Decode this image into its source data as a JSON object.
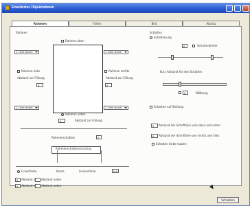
{
  "window": {
    "title": "Erweitertes Objektrahmen"
  },
  "tabs": [
    {
      "label": "Rahmen"
    },
    {
      "label": "Füllen"
    },
    {
      "label": "Bild"
    },
    {
      "label": "Absatz"
    }
  ],
  "left": {
    "rahmen_label": "Rahmen",
    "top_line_checkbox": "Rahmen oben",
    "top_line_distance_label": "Abstand zur Füllung",
    "top_distance_value": "0",
    "left_dropdown": "1 Linie durch",
    "left_line_checkbox": "Rahmen links",
    "left_distance_label": "Abstand zur Füllung",
    "left_distance_value": "0",
    "right_dropdown": "1 Linie durch",
    "right_line_checkbox": "Rahmen rechts",
    "right_distance_label": "Abstand zur Füllung",
    "right_distance_value": "0",
    "bottom_left_dropdown": "1 Linie durch",
    "bottom_right_dropdown": "1 Linie durch",
    "bottom_line_checkbox": "Rahmen unten",
    "bottom_distance_label": "Abstand zur Füllung",
    "bottom_distance_value": "0",
    "shadow_label": "Rahmenschatten",
    "shadow_value": "0",
    "shadow_preview_label": "Rahmenschattenvorschau",
    "line_label": "Linienfarbe",
    "line_value": "Kante",
    "line_strength_label": "Linienstärke",
    "line_strength_value": "0,5",
    "space_top_label": "Abstand oben",
    "space_top_value": "0",
    "space_top_unit": "Abstand unten",
    "space_bottom_label": "Abstand oben",
    "space_bottom_value": "0",
    "space_bottom_unit": "Abstand unten"
  },
  "right": {
    "header": "Schatten",
    "shadow_checkbox": "Schattierung",
    "shadow_value": "0",
    "shadow_unit": "Schattenbreite",
    "slider_label": "Kurz Abstand für den Schatten",
    "value_bottom": "0",
    "unit_bottom": "Wölbung",
    "curve_checkbox": "Schatten auf Stellung",
    "field1_value": "0",
    "field1_label": "Abstand der Schriftlinie vom oben und unten",
    "field2_value": "0",
    "field2_label": "Abstand der Schriftlinie von rechts und links",
    "field3_label": "Schatten farbe nutzen"
  },
  "footer": {
    "button": "Schließen"
  }
}
